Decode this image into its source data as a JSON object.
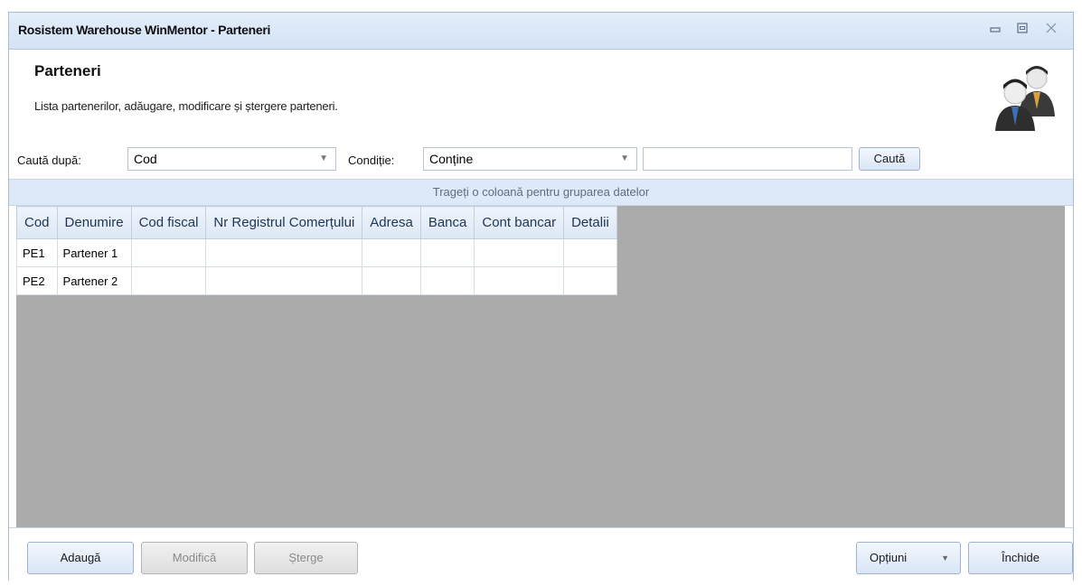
{
  "window": {
    "title": "Rosistem Warehouse WinMentor - Parteneri",
    "minimize_icon": "minimize-icon",
    "restore_icon": "restore-icon",
    "close_icon": "close-icon"
  },
  "header": {
    "title": "Parteneri",
    "subtitle": "Lista partenerilor, adăugare, modificare și ștergere parteneri.",
    "avatar_icon": "partners-avatar-icon"
  },
  "search": {
    "search_by_label": "Caută după:",
    "search_by_value": "Cod",
    "condition_label": "Condiție:",
    "condition_value": "Conține",
    "query_value": "",
    "search_button": "Caută"
  },
  "grid": {
    "group_hint": "Trageți o coloană pentru gruparea datelor",
    "columns": [
      "Cod",
      "Denumire",
      "Cod fiscal",
      "Nr Registrul Comerțului",
      "Adresa",
      "Banca",
      "Cont bancar",
      "Detalii"
    ],
    "rows": [
      [
        "PE1",
        "Partener 1",
        "",
        "",
        "",
        "",
        "",
        ""
      ],
      [
        "PE2",
        "Partener 2",
        "",
        "",
        "",
        "",
        "",
        ""
      ]
    ]
  },
  "footer": {
    "add_button": "Adaugă",
    "modify_button": "Modifică",
    "delete_button": "Șterge",
    "options_button": "Opțiuni",
    "close_button": "Închide"
  },
  "colors": {
    "title_bar": "#d8e5f6",
    "group_bar": "#dde9f7",
    "grid_empty": "#ababab",
    "button_border": "#9fb3cf"
  }
}
